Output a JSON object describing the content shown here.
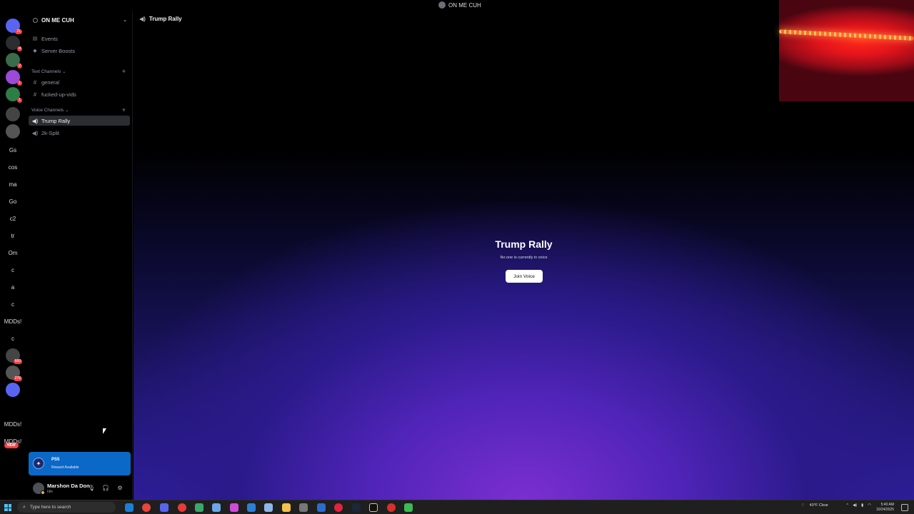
{
  "window": {
    "title": "ON ME CUH"
  },
  "rail": {
    "servers": [
      {
        "label": "",
        "type": "img",
        "badge": "21"
      },
      {
        "label": "",
        "type": "img",
        "badge": "4"
      },
      {
        "label": "",
        "type": "img",
        "badge": "2"
      },
      {
        "label": "",
        "type": "img",
        "badge": "1"
      },
      {
        "label": "",
        "type": "img",
        "badge": "1"
      },
      {
        "label": "",
        "type": "img",
        "badge": ""
      },
      {
        "label": "",
        "type": "img",
        "badge": ""
      },
      {
        "label": "Gs",
        "type": "text",
        "badge": ""
      },
      {
        "label": "cos",
        "type": "text",
        "badge": ""
      },
      {
        "label": "ma",
        "type": "text",
        "badge": ""
      },
      {
        "label": "Go",
        "type": "text",
        "badge": ""
      },
      {
        "label": "c2",
        "type": "text",
        "badge": ""
      },
      {
        "label": "tr",
        "type": "text",
        "badge": ""
      },
      {
        "label": "Om",
        "type": "text",
        "badge": ""
      },
      {
        "label": "c",
        "type": "text",
        "badge": ""
      },
      {
        "label": "a",
        "type": "text",
        "badge": ""
      },
      {
        "label": "c",
        "type": "text",
        "badge": ""
      },
      {
        "label": "MDDs!",
        "type": "text",
        "badge": ""
      },
      {
        "label": "c",
        "type": "text",
        "badge": ""
      },
      {
        "label": "",
        "type": "img",
        "badge": "660"
      },
      {
        "label": "",
        "type": "img",
        "badge": "276"
      },
      {
        "label": "",
        "type": "img",
        "badge": ""
      },
      {
        "label": "MDDs!",
        "type": "text",
        "badge": ""
      },
      {
        "label": "MDDs!",
        "type": "text",
        "badge": ""
      }
    ],
    "new_tag": "NEW"
  },
  "sidebar": {
    "guild_name": "ON ME CUH",
    "nav": [
      {
        "label": "Events",
        "icon": "calendar-icon"
      },
      {
        "label": "Server Boosts",
        "icon": "boost-icon"
      }
    ],
    "text_category": "Text Channels",
    "text_channels": [
      "general",
      "fucked-up-vids"
    ],
    "voice_category": "Voice Channels",
    "voice_channels": [
      "Trump Rally",
      "2k-Split"
    ]
  },
  "reward": {
    "brand": "PS5",
    "text": "Reward Available"
  },
  "user": {
    "name": "Marshon Da Don",
    "status": "Idle"
  },
  "main": {
    "channel": "Trump Rally",
    "stage_title": "Trump Rally",
    "stage_subtitle": "No one is currently in voice",
    "join_label": "Join Voice"
  },
  "taskbar": {
    "search_placeholder": "Type here to search",
    "weather": "40°F Clear",
    "time": "5:40 AM",
    "date": "10/24/2025"
  }
}
